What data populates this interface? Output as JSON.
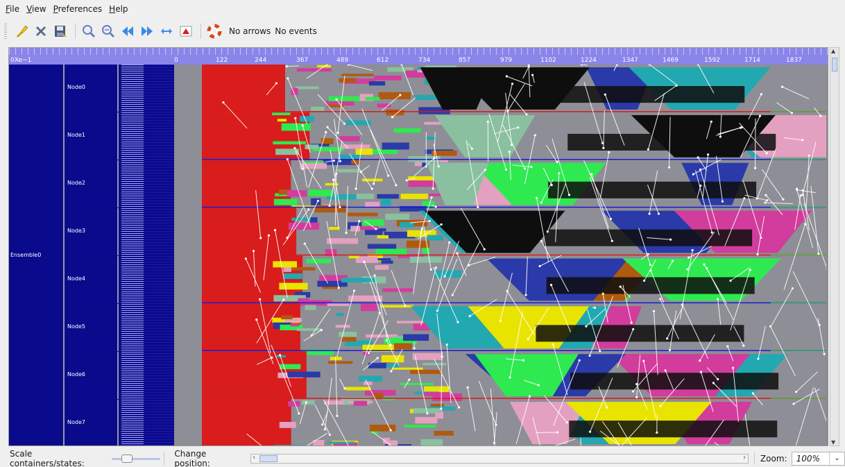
{
  "menu": {
    "items": [
      {
        "label": "File",
        "mnemonic": "F",
        "rest": "ile"
      },
      {
        "label": "View",
        "mnemonic": "V",
        "rest": "iew"
      },
      {
        "label": "Preferences",
        "mnemonic": "P",
        "rest": "references"
      },
      {
        "label": "Help",
        "mnemonic": "H",
        "rest": "elp"
      }
    ]
  },
  "toolbar": {
    "icons": [
      "brush-icon",
      "close-icon",
      "save-icon",
      "zoom-in-icon",
      "zoom-out-icon",
      "previous-icon",
      "next-icon",
      "fit-width-icon",
      "scroll-top-icon",
      "help-lifebuoy-icon"
    ],
    "arrows_label": "No arrows",
    "events_label": "No events"
  },
  "ruler": {
    "labels": [
      "0Xe−1",
      "0",
      "122",
      "244",
      "367",
      "489",
      "612",
      "734",
      "857",
      "979",
      "1102",
      "1224",
      "1347",
      "1469",
      "1592",
      "1714",
      "1837"
    ]
  },
  "tree": {
    "ensemble": "Ensemble0",
    "nodes": [
      "Node0",
      "Node1",
      "Node2",
      "Node3",
      "Node4",
      "Node5",
      "Node6",
      "Node7"
    ]
  },
  "colors": {
    "ruler": "#8a85e8",
    "tree_bg": "#0a0a8c",
    "separator_line": "#1a1ad0",
    "separator_red": "#d81a1a",
    "separator_green": "#2ad83a",
    "arrow": "#ffffff",
    "state_colors": [
      "#d91c1c",
      "#e8e400",
      "#2eea50",
      "#b05a10",
      "#e4a0c0",
      "#22a8b0",
      "#d23c9c",
      "#2a3aa8",
      "#8ac0a0",
      "#0e0e0e"
    ]
  },
  "bottombar": {
    "scale_label": "Scale containers/states:",
    "scale_value_pct": 25,
    "position_label": "Change position:",
    "position_value_pct": 2,
    "zoom_label": "Zoom:",
    "zoom_value": "100%"
  }
}
